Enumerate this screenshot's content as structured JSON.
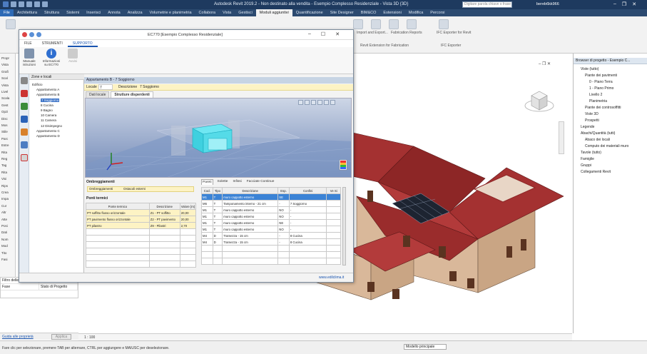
{
  "revit": {
    "window_title": "Autodesk Revit 2019.2 - Non destinato alla vendita - Esempio Complesso Residenziale - Vista 3D {3D}",
    "search_placeholder": "Digitare parola chiave o frase",
    "user": "bereb6kk966",
    "ribbon_tabs": [
      "File",
      "Architettura",
      "Struttura",
      "Sistemi",
      "Inserisci",
      "Annota",
      "Analizza",
      "Volumetrie e planimetria",
      "Collabora",
      "Vista",
      "Gestisci",
      "Moduli aggiuntivi",
      "Quantificazione",
      "Site Designer",
      "BIM&CO",
      "Estensioni",
      "Modifica",
      "Percorsi"
    ],
    "active_ribbon_tab": 11,
    "ribbon_labels": {
      "fabrication": "Revit Extension for Fabrication",
      "import_export": "Import and Export...",
      "fab_reports": "Fabrication Reports",
      "ifc_exporter": "IFC Exporter for Revit",
      "ifc_group": "IFC Exporter"
    },
    "left_panel_labels": [
      "Propr",
      "Vista",
      "Grafi",
      "Scal",
      "Vista",
      "Livel",
      "Scala",
      "Gest",
      "Opzi",
      "Disc",
      "Mos",
      "Stile",
      "Parc",
      "Estre",
      "Rita",
      "Reg",
      "Tag",
      "Rita",
      "Visi",
      "Rips",
      "Crea",
      "Impa",
      "Cur",
      "Altr",
      "Atte",
      "Posi",
      "Dati",
      "Nom",
      "Mod",
      "Tito",
      "Fasi"
    ],
    "properties": [
      {
        "name": "Filtro delle fasi",
        "value": "Mostra tutto"
      },
      {
        "name": "Fase",
        "value": "Stato di Progetto"
      }
    ],
    "properties_help": "Guida alle proprietà",
    "apply_label": "Applica",
    "view_scale": "1 : 100",
    "status_text": "Fare clic per selezionare, premere TAB per alternare, CTRL per aggiungere e MAIUSC per deselezionare.",
    "model_select": "Modello principale",
    "project_browser": {
      "header": "Browser di progetto - Esempio C...",
      "items": [
        {
          "label": "Viste (tutto)",
          "indent": 1
        },
        {
          "label": "Piante dei pavimenti",
          "indent": 2
        },
        {
          "label": "0 - Piano Terra",
          "indent": 3
        },
        {
          "label": "1 - Piano Primo",
          "indent": 3
        },
        {
          "label": "Livello 2",
          "indent": 3
        },
        {
          "label": "Planimetria",
          "indent": 3
        },
        {
          "label": "Piante dei controsoffitti",
          "indent": 2
        },
        {
          "label": "Viste 3D",
          "indent": 2
        },
        {
          "label": "Prospetti",
          "indent": 2
        },
        {
          "label": "Legende",
          "indent": 1
        },
        {
          "label": "Abachi/Quantità (tutti)",
          "indent": 1
        },
        {
          "label": "Abaco dei locali",
          "indent": 2
        },
        {
          "label": "Computo dei materiali muro",
          "indent": 2
        },
        {
          "label": "Tavole (tutto)",
          "indent": 1
        },
        {
          "label": "Famiglie",
          "indent": 1
        },
        {
          "label": "Gruppi",
          "indent": 1
        },
        {
          "label": "Collegamenti Revit",
          "indent": 1
        }
      ]
    }
  },
  "ec": {
    "title": "EC770 [Esempio Complesso Residenziale]",
    "menu_tabs": [
      "FILE",
      "STRUMENTI",
      "SUPPORTO"
    ],
    "active_menu_tab": 2,
    "ribbon_buttons": [
      {
        "label": "Manuale istruzioni"
      },
      {
        "label": "Informazioni su EC770"
      },
      {
        "label": "Avvisi"
      }
    ],
    "tree_header": "Zone e locali",
    "tree": [
      {
        "label": "Edificio",
        "indent": 0,
        "sel": false
      },
      {
        "label": "Appartamento A",
        "indent": 1,
        "sel": false
      },
      {
        "label": "Appartamento B",
        "indent": 1,
        "sel": false
      },
      {
        "label": "7 Soggiorno",
        "indent": 2,
        "sel": true
      },
      {
        "label": "8 Cucina",
        "indent": 2,
        "sel": false
      },
      {
        "label": "9 Bagno",
        "indent": 2,
        "sel": false
      },
      {
        "label": "10 Camera",
        "indent": 2,
        "sel": false
      },
      {
        "label": "11 Camera",
        "indent": 2,
        "sel": false
      },
      {
        "label": "12 Disimpegno",
        "indent": 2,
        "sel": false
      },
      {
        "label": "Appartamento C",
        "indent": 1,
        "sel": false
      },
      {
        "label": "Appartamento D",
        "indent": 1,
        "sel": false
      }
    ],
    "crumb": "Appartamento B - 7 Soggiorno",
    "locale_label": "Locale",
    "locale_value": "7",
    "descr_label": "Descrizione",
    "descr_value": "7 Soggiorno",
    "sub_tabs": [
      "Dati locale",
      "Strutture disperdenti"
    ],
    "active_sub_tab": 1,
    "ombr": {
      "title": "Ombreggiamenti",
      "label": "Ombreggiamenti",
      "value": "Ostacoli esterni"
    },
    "ponti": {
      "title": "Ponti termici",
      "headers": [
        "Ponte termico",
        "Descrizione",
        "Valore [m]"
      ],
      "rows": [
        [
          "PT soffitto flusso orizzontale",
          "Z1 - PT soffitto",
          "20,00"
        ],
        [
          "PT pavimento flusso orizzontale",
          "Z2 - PT pavimento",
          "20,00"
        ],
        [
          "PT pilastro",
          "Z9 - Pilastri",
          "2,70"
        ]
      ]
    },
    "pareti": {
      "tabs": [
        "Pareti",
        "Solette",
        "Infissi",
        "Facciate Continue"
      ],
      "active_tab": 0,
      "headers": [
        "Cod.",
        "Tipo",
        "Descrizione",
        "Esp.",
        "Confini",
        "Ve Si"
      ],
      "rows": [
        [
          "M1",
          "T",
          "muro cappotto esterno",
          "SE",
          "",
          ""
        ],
        [
          "M6",
          "T",
          "Tamponamento interno - 21 cm",
          "-",
          "7 Soggiorno",
          ""
        ],
        [
          "M1",
          "T",
          "muro cappotto esterno",
          "NO",
          "-",
          ""
        ],
        [
          "M1",
          "T",
          "muro cappotto esterno",
          "NO",
          "-",
          ""
        ],
        [
          "M1",
          "T",
          "muro cappotto esterno",
          "NE",
          "-",
          ""
        ],
        [
          "M1",
          "T",
          "muro cappotto esterno",
          "NO",
          "-",
          ""
        ],
        [
          "M4",
          "D",
          "Tramezza - 15 cm",
          "-",
          "8 Cucina",
          ""
        ],
        [
          "M4",
          "D",
          "Tramezza - 15 cm",
          "-",
          "8 Cucina",
          ""
        ]
      ],
      "selected_row": 0
    },
    "footer_url": "www.edilclima.it"
  },
  "colors": {
    "revit_title": "#1e3a5f",
    "roof": "#9e2b2b",
    "wall": "#e7cdb6",
    "accent": "#1a55b0",
    "highlight": "#3b83d6",
    "yellow": "#fdf3c4"
  }
}
